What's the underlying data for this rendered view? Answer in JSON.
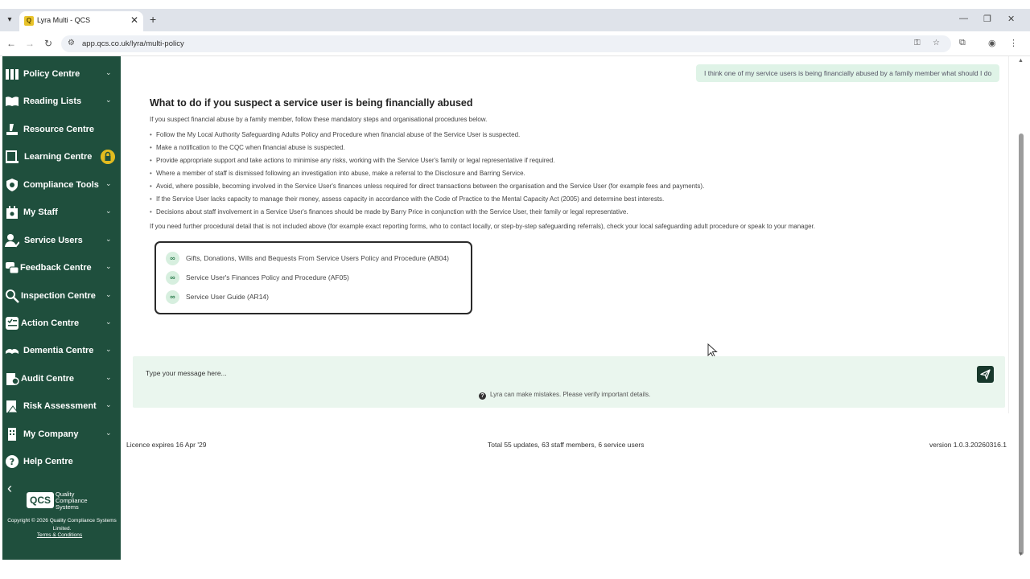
{
  "browser": {
    "tab_title": "Lyra Multi - QCS",
    "tab_favicon": "Q",
    "new_tab_label": "+",
    "url": "app.qcs.co.uk/lyra/multi-policy"
  },
  "sidebar": {
    "items": [
      {
        "label": "Policy Centre",
        "icon": "policy-icon"
      },
      {
        "label": "Reading Lists",
        "icon": "book-icon"
      },
      {
        "label": "Resource Centre",
        "icon": "resource-icon"
      },
      {
        "label": "Learning Centre",
        "icon": "learning-icon",
        "locked": true
      },
      {
        "label": "Compliance Tools",
        "icon": "shield-icon"
      },
      {
        "label": "My Staff",
        "icon": "staff-icon"
      },
      {
        "label": "Service Users",
        "icon": "users-icon"
      },
      {
        "label": "Feedback Centre",
        "icon": "feedback-icon"
      },
      {
        "label": "Inspection Centre",
        "icon": "inspection-icon"
      },
      {
        "label": "Action Centre",
        "icon": "checklist-icon"
      },
      {
        "label": "Dementia Centre",
        "icon": "hands-icon"
      },
      {
        "label": "Audit Centre",
        "icon": "audit-icon"
      },
      {
        "label": "Risk Assessment",
        "icon": "risk-icon"
      },
      {
        "label": "My Company",
        "icon": "building-icon"
      },
      {
        "label": "Help Centre",
        "icon": "help-icon"
      }
    ],
    "logo_text": "QCS",
    "logo_wordmark": "Quality\nCompliance\nSystems",
    "copyright": "Copyright © 2026 Quality Compliance Systems Limited.",
    "terms_label": "Terms & Conditions"
  },
  "chat": {
    "user_message": "I think one of my service users is being financially abused by a family member what should I do",
    "answer_title": "What to do if you suspect a service user is being financially abused",
    "intro": "If you suspect financial abuse by a family member, follow these mandatory steps and organisational procedures below.",
    "bullets": [
      "Follow the My Local Authority Safeguarding Adults Policy and Procedure when financial abuse of the Service User is suspected.",
      "Make a notification to the CQC when financial abuse is suspected.",
      "Provide appropriate support and take actions to minimise any risks, working with the Service User's family or legal representative if required.",
      "Where a member of staff is dismissed following an investigation into abuse, make a referral to the Disclosure and Barring Service.",
      "Avoid, where possible, becoming involved in the Service User's finances unless required for direct transactions between the organisation and the Service User (for example fees and payments).",
      "If the Service User lacks capacity to manage their money, assess capacity in accordance with the Code of Practice to the Mental Capacity Act (2005) and determine best interests.",
      "Decisions about staff involvement in a Service User's finances should be made by Barry Price in conjunction with the Service User, their family or legal representative."
    ],
    "outro": "If you need further procedural detail that is not included above (for example exact reporting forms, who to contact locally, or step-by-step safeguarding referrals), check your local safeguarding adult procedure or speak to your manager.",
    "references": [
      "Gifts, Donations, Wills and Bequests From Service Users Policy and Procedure (AB04)",
      "Service User's Finances Policy and Procedure (AF05)",
      "Service User Guide (AR14)"
    ],
    "input_placeholder": "Type your message here...",
    "disclaimer": "Lyra can make mistakes. Please verify important details."
  },
  "footer": {
    "licence": "Licence expires 16 Apr '29",
    "totals": "Total 55 updates, 63 staff members, 6 service users",
    "version": "version 1.0.3.20260316.1"
  },
  "colors": {
    "sidebar_bg": "#1f4f3d",
    "accent_light": "#eaf6ee",
    "bubble_bg": "#dff3e7",
    "send_button": "#18382c",
    "lock_badge": "#e2bb1f"
  }
}
